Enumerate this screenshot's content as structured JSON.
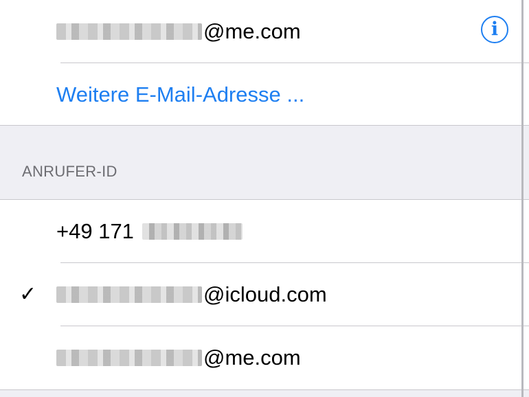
{
  "email_section": {
    "rows": [
      {
        "suffix": "@me.com",
        "blurred": true
      },
      {
        "link_label": "Weitere E-Mail-Adresse ..."
      }
    ]
  },
  "caller_id_section": {
    "header": "ANRUFER-ID",
    "rows": [
      {
        "prefix": "+49 171",
        "blurred": true,
        "selected": false
      },
      {
        "suffix": "@icloud.com",
        "blurred": true,
        "selected": true
      },
      {
        "suffix": "@me.com",
        "blurred": true,
        "selected": false
      }
    ]
  },
  "icons": {
    "info": "info-icon",
    "check": "checkmark-icon"
  },
  "colors": {
    "accent": "#1e7ff1",
    "background": "#efeff4",
    "separator": "#c8c7cc",
    "header_text": "#6d6d72"
  }
}
